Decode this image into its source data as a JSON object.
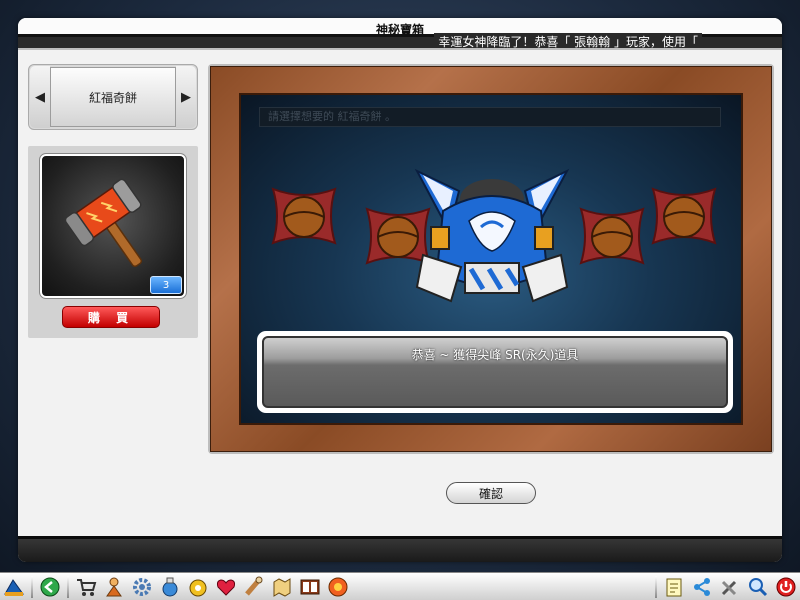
{
  "window": {
    "title": "神秘寶箱",
    "marquee": "幸運女神降臨了！恭喜「 張翰翰 」玩家，使用「"
  },
  "selector": {
    "item_name": "紅福奇餅",
    "arrow_left": "◀",
    "arrow_right": "▶"
  },
  "item_panel": {
    "icon": "hammer-icon",
    "count": "3",
    "buy_label": "購 買"
  },
  "result": {
    "prompt": "請選擇想要的 紅福奇餅 。",
    "message": "恭喜 ~ 獲得尖峰 SR(永久)道具",
    "prize_icon": "kart-body-icon",
    "cookie_icon": "fortune-cookie-icon"
  },
  "confirm_label": "確認",
  "taskbar": {
    "icons": [
      "kart-logo-icon",
      "back-icon",
      "shop-cart-icon",
      "character-icon",
      "gear-icon",
      "potion-icon",
      "item-bag-icon",
      "heart-icon",
      "scroll-icon",
      "map-icon",
      "book-icon",
      "lucky-wheel-icon",
      "memo-icon",
      "share-icon",
      "tools-icon",
      "search-icon",
      "power-icon"
    ]
  },
  "colors": {
    "buy_button": "#c20000",
    "count_badge": "#1a6fd6",
    "frame_wood": "#8a4b25",
    "board": "#173652"
  }
}
